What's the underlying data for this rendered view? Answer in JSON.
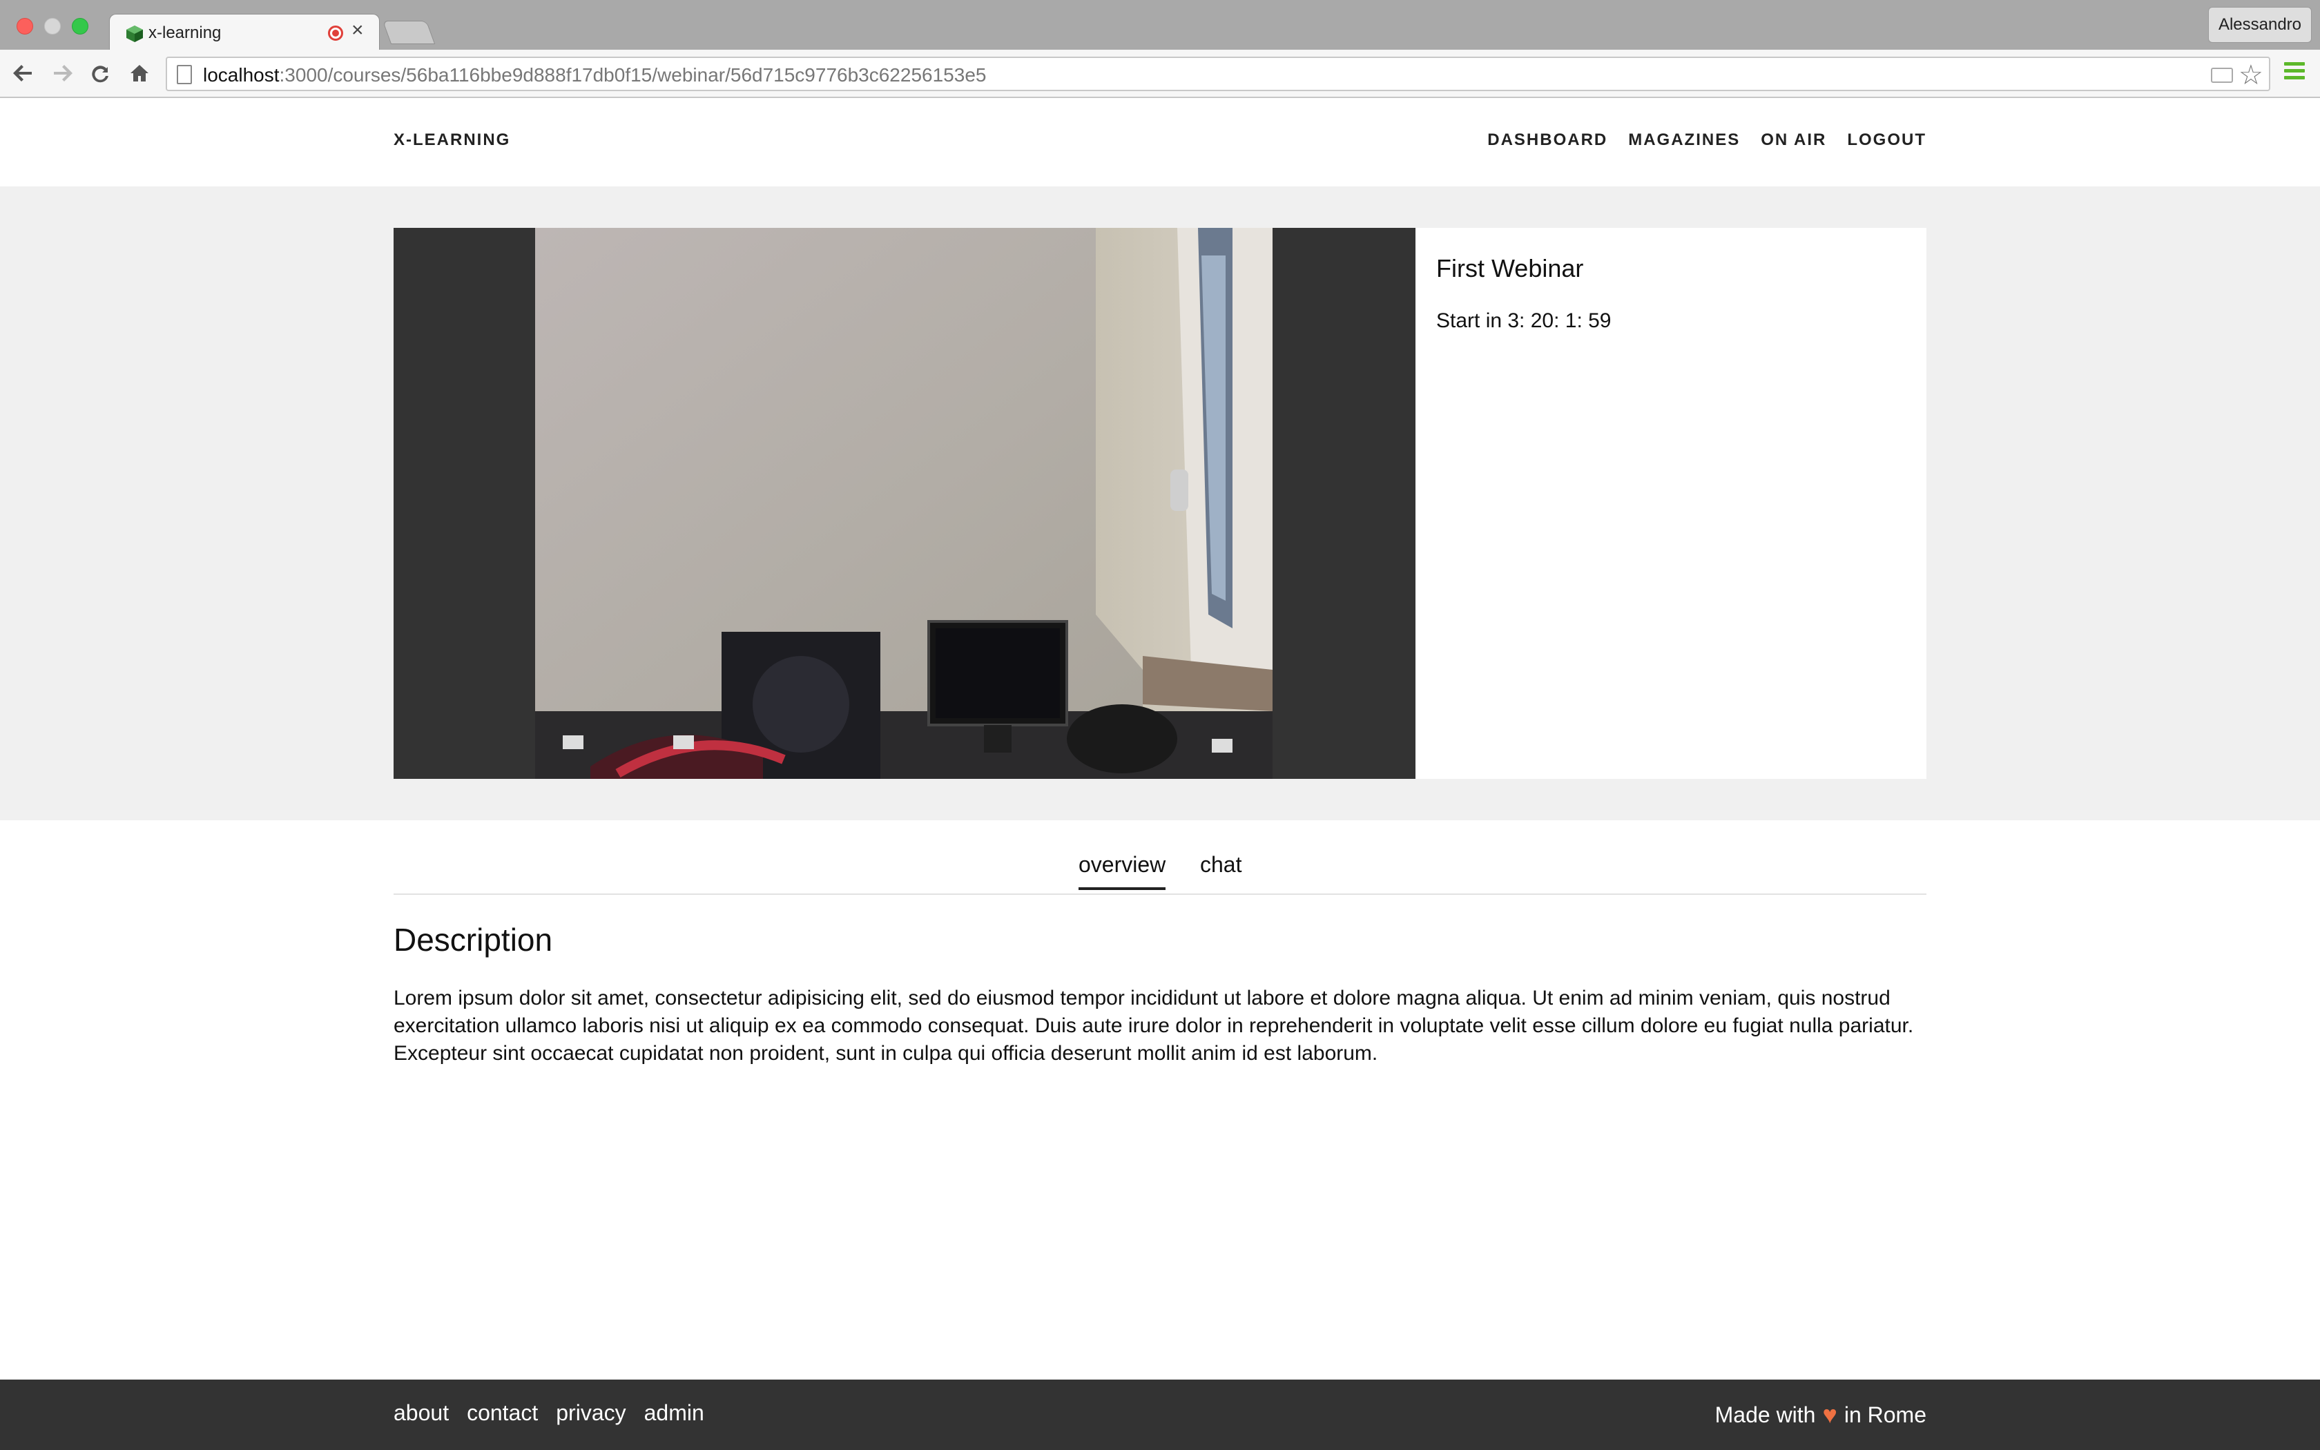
{
  "browser": {
    "tab_title": "x-learning",
    "profile_name": "Alessandro",
    "url_host": "localhost",
    "url_path": ":3000/courses/56ba116bbe9d888f17db0f15/webinar/56d715c9776b3c62256153e5"
  },
  "header": {
    "brand": "X-LEARNING",
    "nav": [
      "DASHBOARD",
      "MAGAZINES",
      "ON AIR",
      "LOGOUT"
    ]
  },
  "webinar": {
    "title": "First Webinar",
    "countdown": "Start in 3: 20: 1: 59"
  },
  "tabs": [
    "overview",
    "chat"
  ],
  "active_tab": "overview",
  "description": {
    "heading": "Description",
    "text": "Lorem ipsum dolor sit amet, consectetur adipisicing elit, sed do eiusmod tempor incididunt ut labore et dolore magna aliqua. Ut enim ad minim veniam, quis nostrud exercitation ullamco laboris nisi ut aliquip ex ea commodo consequat. Duis aute irure dolor in reprehenderit in voluptate velit esse cillum dolore eu fugiat nulla pariatur. Excepteur sint occaecat cupidatat non proident, sunt in culpa qui officia deserunt mollit anim id est laborum."
  },
  "footer": {
    "links": [
      "about",
      "contact",
      "privacy",
      "admin"
    ],
    "made_prefix": "Made with",
    "made_suffix": "in Rome"
  },
  "colors": {
    "accent_heart": "#ef7142",
    "hero_bg": "#f0f0f0",
    "player_bg": "#333333",
    "footer_bg": "#333333"
  }
}
